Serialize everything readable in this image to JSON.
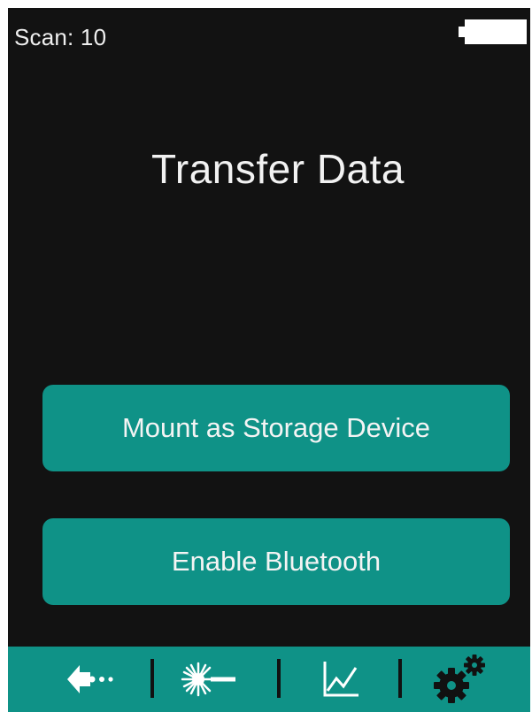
{
  "status": {
    "scan_label": "Scan: 10",
    "battery_icon": "battery-icon"
  },
  "screen": {
    "title": "Transfer Data"
  },
  "actions": [
    {
      "label": "Mount as Storage Device"
    },
    {
      "label": "Enable Bluetooth"
    }
  ],
  "nav": [
    {
      "icon": "back-arrow-icon"
    },
    {
      "icon": "laser-icon"
    },
    {
      "icon": "chart-icon"
    },
    {
      "icon": "settings-gears-icon"
    }
  ],
  "colors": {
    "background": "#121212",
    "accent": "#0f9287",
    "text": "#f2f2f2"
  }
}
